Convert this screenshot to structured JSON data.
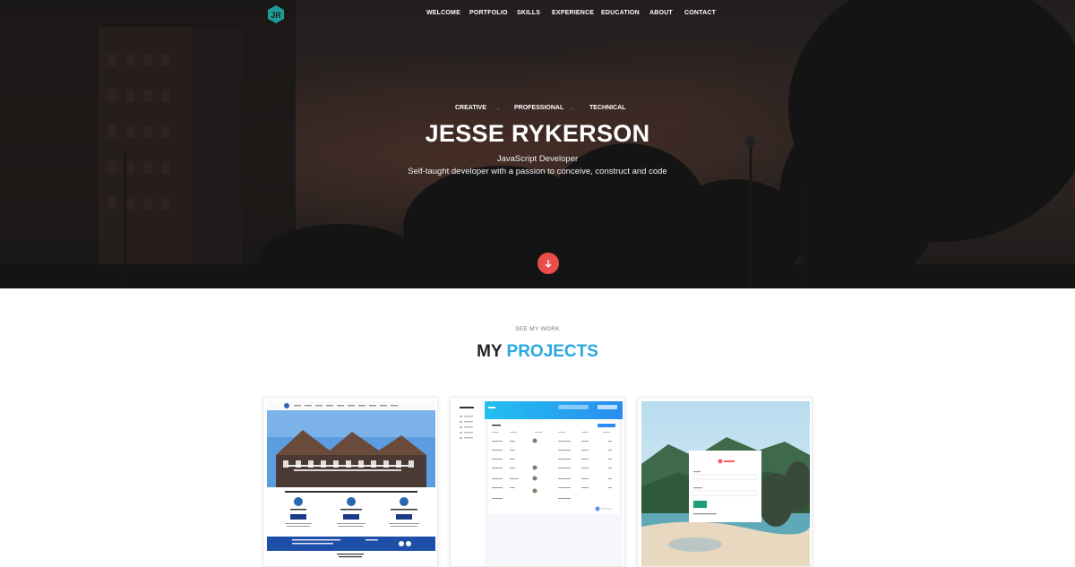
{
  "nav": {
    "logo_text": "JR",
    "items": [
      "WELCOME",
      "PORTFOLIO",
      "SKILLS",
      "EXPERIENCE",
      "EDUCATION",
      "ABOUT",
      "CONTACT"
    ]
  },
  "hero": {
    "taglines": [
      "CREATIVE",
      "PROFESSIONAL",
      "TECHNICAL"
    ],
    "separator": ".",
    "name": "JESSE RYKERSON",
    "role": "JavaScript Developer",
    "description": "Self-taught developer with a passion to conceive, construct and code"
  },
  "projects": {
    "subtitle": "SEE MY WORK",
    "title_main": "MY",
    "title_accent": "PROJECTS",
    "cards": [
      {
        "name": "project-card-1",
        "icon": "website-thumbnail"
      },
      {
        "name": "project-card-2",
        "icon": "dashboard-thumbnail"
      },
      {
        "name": "project-card-3",
        "icon": "login-thumbnail"
      }
    ]
  },
  "colors": {
    "accent_blue": "#29a9e1",
    "scroll_button": "#e94e4a",
    "logo_teal": "#1f9d95"
  }
}
